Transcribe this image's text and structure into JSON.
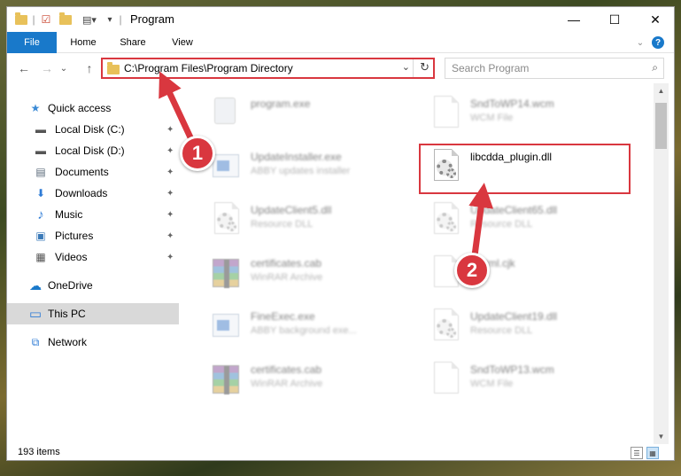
{
  "window": {
    "title": "Program",
    "controls": {
      "minimize": "—",
      "maximize": "☐",
      "close": "✕"
    }
  },
  "ribbon": {
    "tabs": [
      {
        "label": "File",
        "active": true
      },
      {
        "label": "Home"
      },
      {
        "label": "Share"
      },
      {
        "label": "View"
      }
    ],
    "expand_icon": "chevron-down-icon",
    "help_icon": "help-icon"
  },
  "nav": {
    "back": "←",
    "forward": "→",
    "recent": "⌄",
    "up": "↑",
    "address": "C:\\Program Files\\Program Directory",
    "refresh": "↻",
    "dropdown": "⌄",
    "search_placeholder": "Search Program",
    "search_icon": "⌕"
  },
  "sidebar": {
    "items": [
      {
        "label": "Quick access",
        "icon": "star-icon",
        "glyph": "★",
        "color": "#3a8ad6"
      },
      {
        "label": "Local Disk (C:)",
        "icon": "drive-icon",
        "glyph": "▬",
        "color": "#555555",
        "pinned": true
      },
      {
        "label": "Local Disk (D:)",
        "icon": "drive-icon",
        "glyph": "▬",
        "color": "#555555",
        "pinned": true
      },
      {
        "label": "Documents",
        "icon": "documents-icon",
        "glyph": "▤",
        "color": "#5a6a7a",
        "pinned": true
      },
      {
        "label": "Downloads",
        "icon": "downloads-icon",
        "glyph": "⬇",
        "color": "#2e7bd6",
        "pinned": true
      },
      {
        "label": "Music",
        "icon": "music-icon",
        "glyph": "♪",
        "color": "#2e7bd6",
        "pinned": true
      },
      {
        "label": "Pictures",
        "icon": "pictures-icon",
        "glyph": "▣",
        "color": "#3a7ab8",
        "pinned": true
      },
      {
        "label": "Videos",
        "icon": "videos-icon",
        "glyph": "▦",
        "color": "#555555",
        "pinned": true
      },
      {
        "label": "OneDrive",
        "icon": "cloud-icon",
        "glyph": "☁",
        "color": "#1979ca"
      },
      {
        "label": "This PC",
        "icon": "computer-icon",
        "glyph": "▭",
        "color": "#2e7bd6",
        "selected": true
      },
      {
        "label": "Network",
        "icon": "network-icon",
        "glyph": "⧉",
        "color": "#2e7bd6"
      }
    ],
    "pin_glyph": "📌"
  },
  "files": {
    "left": [
      {
        "name": "program.exe",
        "type": "",
        "kind": "exe"
      },
      {
        "name": "UpdateInstaller.exe",
        "type": "ABBY updates installer",
        "kind": "app"
      },
      {
        "name": "UpdateClient5.dll",
        "type": "Resource DLL",
        "kind": "dll"
      },
      {
        "name": "certificates.cab",
        "type": "WinRAR Archive",
        "kind": "rar"
      },
      {
        "name": "FineExec.exe",
        "type": "ABBY background exe...",
        "kind": "app"
      },
      {
        "name": "certificates.cab",
        "type": "WinRAR Archive",
        "kind": "rar"
      }
    ],
    "right": [
      {
        "name": "SndToWP14.wcm",
        "type": "WCM File",
        "kind": "doc"
      },
      {
        "name": "libcdda_plugin.dll",
        "type": "",
        "kind": "dll",
        "highlighted": true
      },
      {
        "name": "UpdateClient65.dll",
        "type": "Resource DLL",
        "kind": "dll"
      },
      {
        "name": "...html.cjk",
        "type": "...e",
        "kind": "doc"
      },
      {
        "name": "UpdateClient19.dll",
        "type": "Resource DLL",
        "kind": "dll"
      },
      {
        "name": "SndToWP13.wcm",
        "type": "WCM File",
        "kind": "doc"
      }
    ]
  },
  "status": {
    "count": "193 items"
  },
  "annotations": {
    "badge1": "1",
    "badge2": "2",
    "color": "#d9373f"
  }
}
